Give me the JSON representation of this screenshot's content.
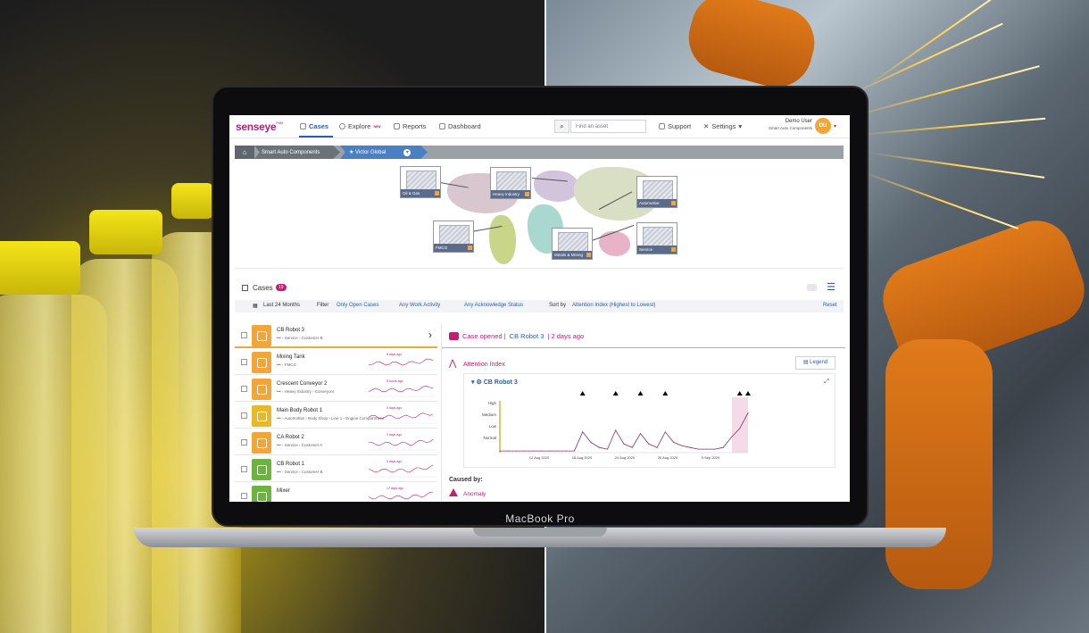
{
  "laptop": {
    "brand": "MacBook Pro"
  },
  "app": {
    "logo": "senseye",
    "logo_tag": "PdM",
    "nav": [
      {
        "label": "Cases",
        "icon": "cases-icon"
      },
      {
        "label": "Explore",
        "badge": "NEW",
        "icon": "explore-icon"
      },
      {
        "label": "Reports",
        "icon": "reports-icon"
      },
      {
        "label": "Dashboard",
        "icon": "dashboard-icon"
      }
    ],
    "search": {
      "placeholder": "Find an asset"
    },
    "support": "Support",
    "settings": "Settings",
    "user": {
      "name": "Demo User",
      "org": "Smart Auto Components",
      "initials": "DU"
    }
  },
  "breadcrumb": {
    "items": [
      "Smart Auto Components",
      "Victor Global"
    ]
  },
  "map": {
    "sectors": [
      "Oil & Gas",
      "Heavy Industry",
      "Automotive",
      "FMCG",
      "Metals & Mining",
      "Service"
    ]
  },
  "cases": {
    "title": "Cases",
    "count": "19",
    "filters": {
      "period": "Last 24 Months",
      "filter_label": "Filter",
      "status": "Only Open Cases",
      "activity": "Any Work Activity",
      "acknowledge": "Any Acknowledge Status",
      "sort_label": "Sort by",
      "sort": "Attention Index (Highest to Lowest)",
      "reset": "Reset"
    },
    "list": [
      {
        "name": "CB Robot 3",
        "path": "••• › Service › Customer B",
        "age": "",
        "color": "#f2a63a"
      },
      {
        "name": "Mixing Tank",
        "path": "••• › FMCG",
        "age": "8 days ago",
        "color": "#f2a63a"
      },
      {
        "name": "Crescent Conveyor 2",
        "path": "••• › Heavy Industry › Conveyors",
        "age": "8 hours ago",
        "color": "#f2a63a"
      },
      {
        "name": "Main Body Robot 1",
        "path": "••• › Automotive › Body Shop › Line 1 › Engine Compartment",
        "age": "4 days ago",
        "color": "#e8b82a"
      },
      {
        "name": "CA Robot 2",
        "path": "••• › Service › Customer A",
        "age": "2 days ago",
        "color": "#f2a63a"
      },
      {
        "name": "CB Robot 1",
        "path": "••• › Service › Customer B",
        "age": "2 days ago",
        "color": "#6cb33f"
      },
      {
        "name": "Mixer",
        "path": "",
        "age": "17 days ago",
        "color": "#6cb33f"
      }
    ]
  },
  "detail": {
    "opened": "Case opened |",
    "asset": "CB Robot 3",
    "age": "| 2 days ago",
    "attention": "Attention Index",
    "legend": "Legend",
    "chart_asset": "CB Robot 3",
    "caused_by": "Caused by:",
    "cause": "Anomaly"
  },
  "chart_data": {
    "type": "line",
    "title": "CB Robot 3",
    "y_tick_labels": [
      "High",
      "Medium",
      "Low",
      "Normal"
    ],
    "x_tick_labels": [
      "12 Aug 2020",
      "18 Aug 2020",
      "24 Aug 2020",
      "30 Aug 2020",
      "5 Sep 2020"
    ],
    "x": [
      0,
      1,
      2,
      3,
      4,
      5,
      6,
      7,
      8,
      9,
      10,
      11,
      12,
      13,
      14,
      15,
      16,
      17,
      18,
      19,
      20,
      21,
      22,
      23,
      24,
      25,
      26,
      27,
      28,
      29,
      30
    ],
    "values": [
      0.1,
      0.1,
      0.1,
      0.1,
      0.1,
      0.1,
      0.1,
      0.1,
      0.1,
      0.1,
      1.2,
      0.6,
      0.3,
      0.2,
      1.3,
      0.5,
      0.3,
      1.1,
      0.5,
      0.3,
      1.2,
      0.6,
      0.4,
      0.3,
      0.2,
      0.2,
      0.2,
      0.3,
      0.9,
      1.4,
      2.3
    ],
    "ylim": [
      0,
      3
    ],
    "grid": false,
    "line_color": "#8a2d6b"
  }
}
